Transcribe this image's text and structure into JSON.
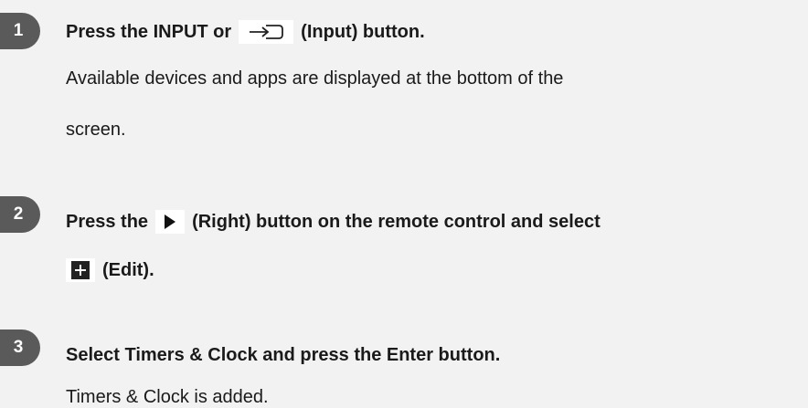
{
  "steps": [
    {
      "number": "1",
      "title_before": "Press the INPUT or",
      "title_after": "(Input) button.",
      "icon": "input-icon",
      "desc_lines": [
        "Available devices and apps are displayed at the bottom of the",
        "screen."
      ]
    },
    {
      "number": "2",
      "title_line1_before": "Press the",
      "title_line1_after": "(Right) button on the remote control and select",
      "title_line2_after": "(Edit).",
      "icons": [
        "right-triangle-icon",
        "edit-plus-icon"
      ]
    },
    {
      "number": "3",
      "title": "Select Timers & Clock and press the Enter button.",
      "desc": "Timers & Clock is added."
    }
  ]
}
